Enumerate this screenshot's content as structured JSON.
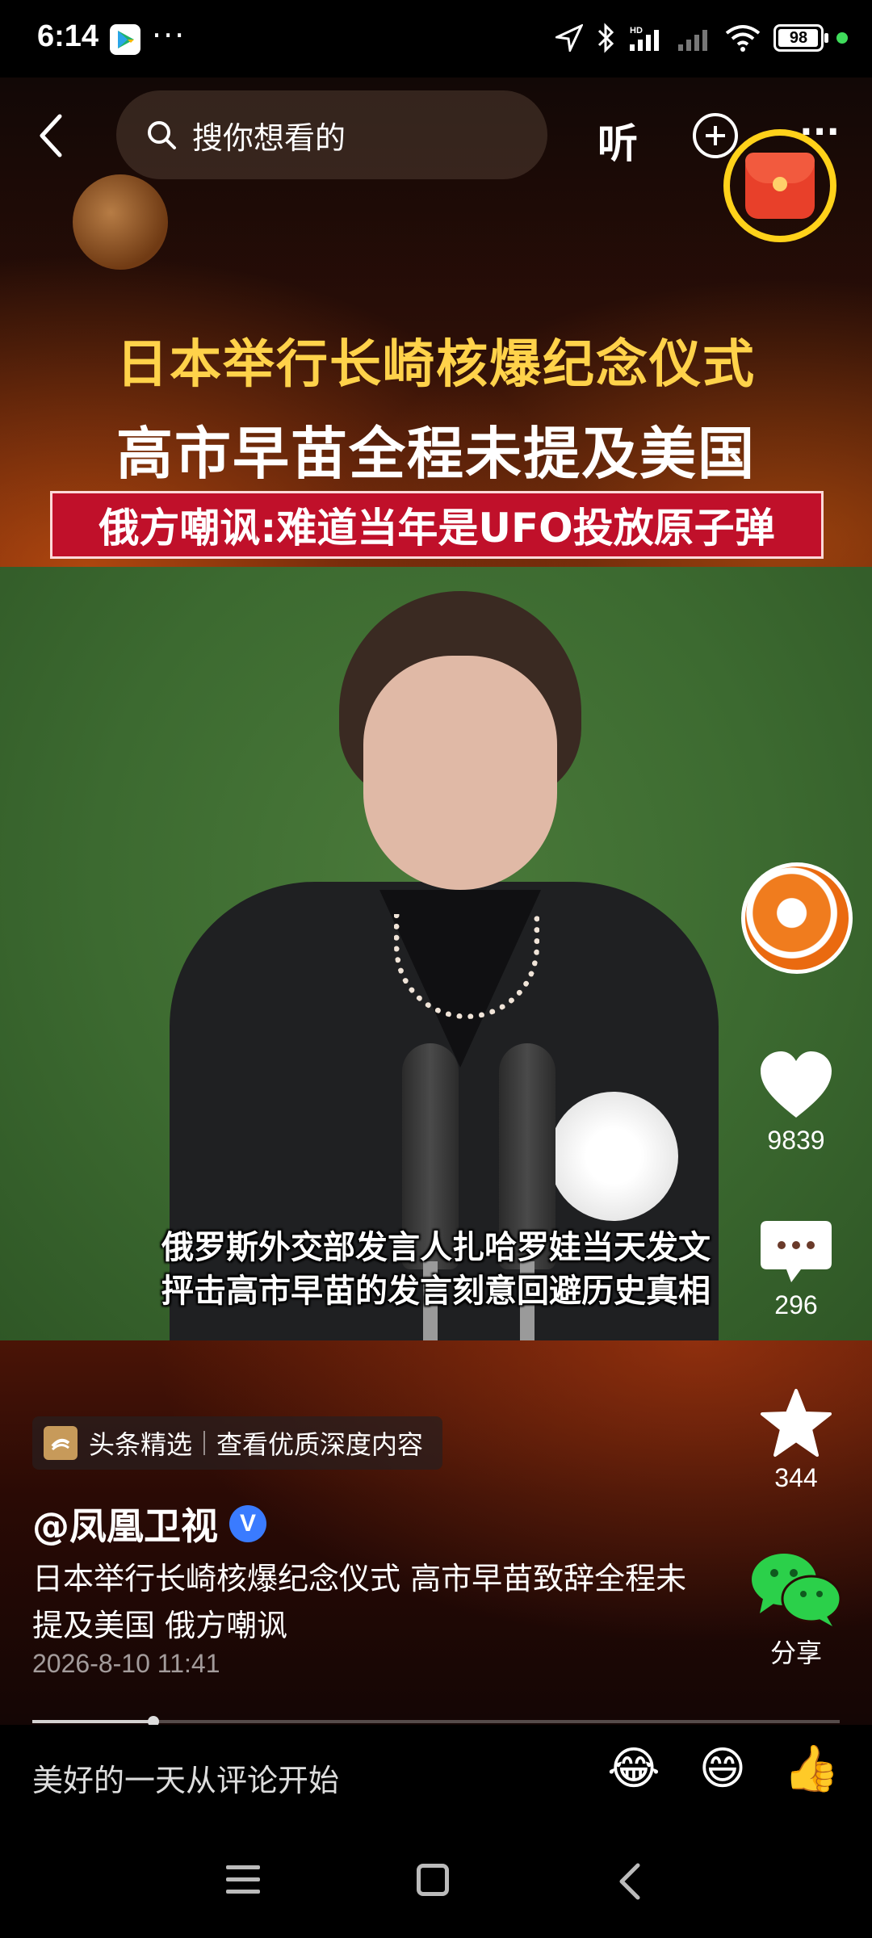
{
  "status_bar": {
    "time": "6:14",
    "dots": "···",
    "battery": "98",
    "battery_level": 0.98,
    "icons": [
      "play-store-icon",
      "location-icon",
      "bluetooth-icon",
      "signal-hd-icon",
      "signal-icon",
      "wifi-icon",
      "battery-icon"
    ]
  },
  "top_nav": {
    "search_placeholder": "搜你想看的",
    "listen_label": "听",
    "more_label": "···"
  },
  "video": {
    "headline_line1": "日本举行长崎核爆纪念仪式",
    "headline_line2": "高市早苗全程未提及美国",
    "headline_line3": "俄方嘲讽:难道当年是UFO投放原子弹",
    "subtitle_line1": "俄罗斯外交部发言人扎哈罗娃当天发文",
    "subtitle_line2": "抨击高市早苗的发言刻意回避历史真相",
    "progress": 0.15
  },
  "actions": {
    "likes": "9839",
    "comments": "296",
    "favorites": "344",
    "share_label": "分享"
  },
  "info": {
    "chip_label": "头条精选",
    "chip_link": "查看优质深度内容",
    "account": "@凤凰卫视",
    "verified_mark": "V",
    "description": "日本举行长崎核爆纪念仪式 高市早苗致辞全程未提及美国 俄方嘲讽",
    "date": "2026-8-10 11:41"
  },
  "comment_bar": {
    "placeholder": "美好的一天从评论开始",
    "emojis": [
      "😂",
      "😄",
      "👍"
    ]
  },
  "colors": {
    "headline_yellow": "#ffd24a",
    "headline_red_band": "#c0102a",
    "verified_blue": "#3a7bff",
    "wechat_green": "#2bd04a"
  }
}
